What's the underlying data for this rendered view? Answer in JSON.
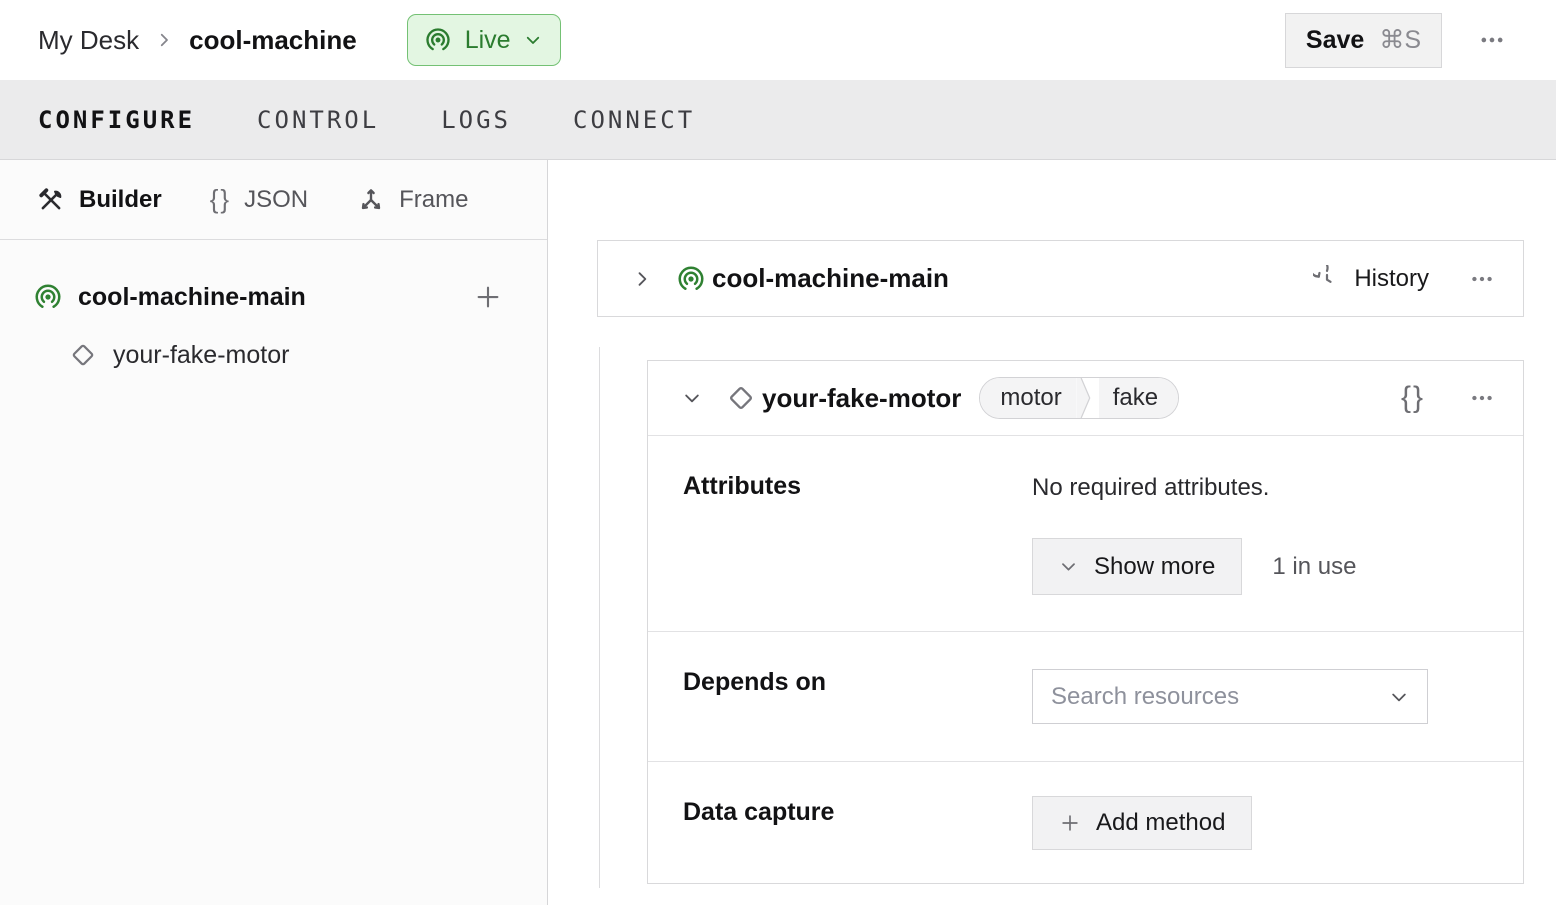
{
  "header": {
    "breadcrumb_parent": "My Desk",
    "breadcrumb_current": "cool-machine",
    "live_label": "Live",
    "save_label": "Save",
    "save_shortcut": "⌘S"
  },
  "tabs": [
    {
      "label": "CONFIGURE"
    },
    {
      "label": "CONTROL"
    },
    {
      "label": "LOGS"
    },
    {
      "label": "CONNECT"
    }
  ],
  "sidebar": {
    "views": [
      {
        "label": "Builder"
      },
      {
        "label": "JSON"
      },
      {
        "label": "Frame"
      }
    ],
    "tree": {
      "machine_label": "cool-machine-main",
      "child_label": "your-fake-motor"
    }
  },
  "main": {
    "machine_card": {
      "title": "cool-machine-main",
      "history_label": "History"
    },
    "component_card": {
      "title": "your-fake-motor",
      "tag_type": "motor",
      "tag_model": "fake",
      "json_icon_glyph": "{}",
      "attributes": {
        "label": "Attributes",
        "empty_text": "No required attributes.",
        "show_more_label": "Show more",
        "in_use_text": "1 in use"
      },
      "depends_on": {
        "label": "Depends on",
        "placeholder": "Search resources"
      },
      "data_capture": {
        "label": "Data capture",
        "add_label": "Add method"
      }
    }
  },
  "colors": {
    "live_text": "#2b7c2f",
    "live_bg": "#e3f6e2",
    "live_border": "#74c174",
    "machine_icon_green": "#2f8132"
  }
}
